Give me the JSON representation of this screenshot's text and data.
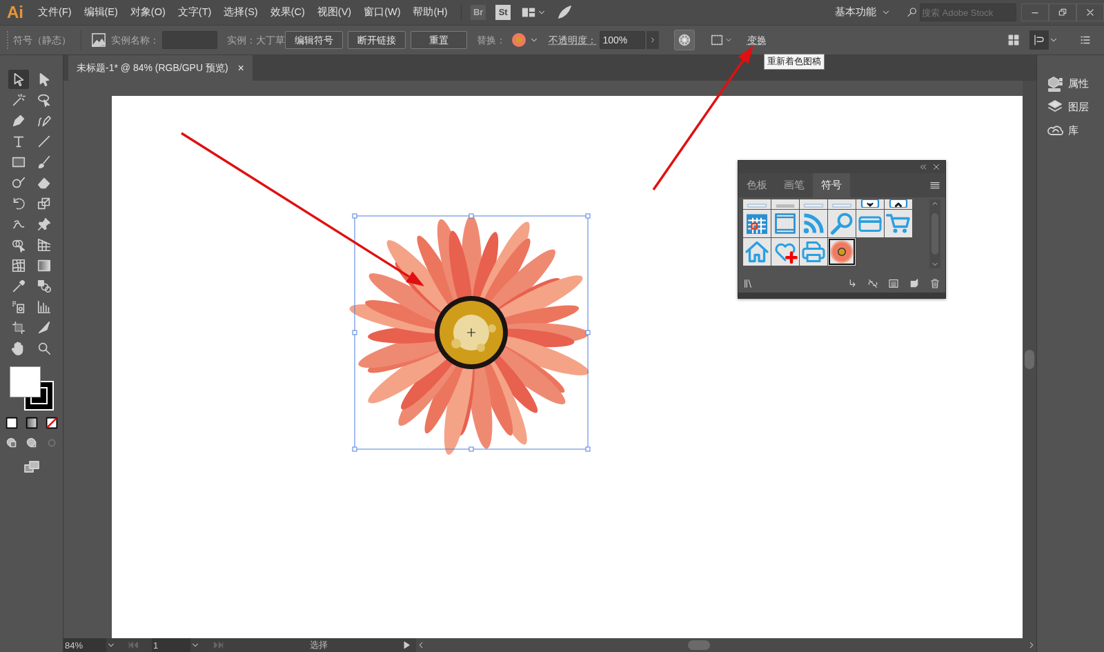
{
  "app_logo": "Ai",
  "menu": [
    "文件(F)",
    "编辑(E)",
    "对象(O)",
    "文字(T)",
    "选择(S)",
    "效果(C)",
    "视图(V)",
    "窗口(W)",
    "帮助(H)"
  ],
  "bridge_button": "Br",
  "stock_button": "St",
  "workspace": "基本功能",
  "search": {
    "placeholder": "搜索 Adobe Stock"
  },
  "control_bar": {
    "object_type": "符号（静态）",
    "instance_name_label": "实例名称：",
    "instance_label": "实例：大丁草",
    "buttons": [
      "编辑符号",
      "断开链接",
      "重置"
    ],
    "replace_label": "替换：",
    "opacity_label": "不透明度：",
    "opacity_value": "100%",
    "transform_link": "变换",
    "tooltip": "重新着色图稿"
  },
  "document_tab": {
    "title": "未标题-1* @ 84% (RGB/GPU 预览)",
    "close": "×"
  },
  "tools": [
    {
      "kind": "arrow",
      "selected": true
    },
    {
      "kind": "arrow-solid",
      "selected": false
    },
    {
      "kind": "wand",
      "selected": false
    },
    {
      "kind": "lasso",
      "selected": false
    },
    {
      "kind": "pen",
      "selected": false
    },
    {
      "kind": "pen-curve",
      "selected": false
    },
    {
      "kind": "type",
      "selected": false
    },
    {
      "kind": "line",
      "selected": false
    },
    {
      "kind": "rect",
      "selected": false
    },
    {
      "kind": "brush",
      "selected": false
    },
    {
      "kind": "blob",
      "selected": false
    },
    {
      "kind": "eraser",
      "selected": false
    },
    {
      "kind": "rotate",
      "selected": false
    },
    {
      "kind": "scale",
      "selected": false
    },
    {
      "kind": "warp",
      "selected": false
    },
    {
      "kind": "pin",
      "selected": false
    },
    {
      "kind": "shape-builder",
      "selected": false
    },
    {
      "kind": "perspective",
      "selected": false
    },
    {
      "kind": "mesh",
      "selected": false
    },
    {
      "kind": "gradient",
      "selected": false
    },
    {
      "kind": "eyedropper",
      "selected": false
    },
    {
      "kind": "blend",
      "selected": false
    },
    {
      "kind": "sprayer",
      "selected": false
    },
    {
      "kind": "graph",
      "selected": false
    },
    {
      "kind": "artboard",
      "selected": false
    },
    {
      "kind": "knife",
      "selected": false
    },
    {
      "kind": "hand",
      "selected": false
    },
    {
      "kind": "zoom",
      "selected": false
    }
  ],
  "right_panel": {
    "items": [
      {
        "kind": "properties",
        "label": "属性"
      },
      {
        "kind": "layers",
        "label": "图层"
      },
      {
        "kind": "libraries",
        "label": "库"
      }
    ]
  },
  "symbols_panel": {
    "tabs": [
      {
        "label": "色板",
        "selected": false
      },
      {
        "label": "画笔",
        "selected": false
      },
      {
        "label": "符号",
        "selected": true
      }
    ],
    "symbols": [
      {
        "kind": "plain",
        "selected": false
      },
      {
        "kind": "gray-bar",
        "selected": false
      },
      {
        "kind": "plain",
        "selected": false
      },
      {
        "kind": "plain",
        "selected": false
      },
      {
        "kind": "button-down",
        "selected": false
      },
      {
        "kind": "button-up",
        "selected": false
      },
      {
        "kind": "calendar",
        "selected": false
      },
      {
        "kind": "film",
        "selected": false
      },
      {
        "kind": "rss",
        "selected": false
      },
      {
        "kind": "magnifier",
        "selected": false
      },
      {
        "kind": "card",
        "selected": false
      },
      {
        "kind": "cart",
        "selected": false
      },
      {
        "kind": "house",
        "selected": false
      },
      {
        "kind": "heart-plus",
        "selected": false
      },
      {
        "kind": "printer",
        "selected": false
      },
      {
        "kind": "flower",
        "selected": true
      }
    ]
  },
  "status_bar": {
    "zoom": "84%",
    "page": "1",
    "tool": "选择"
  }
}
